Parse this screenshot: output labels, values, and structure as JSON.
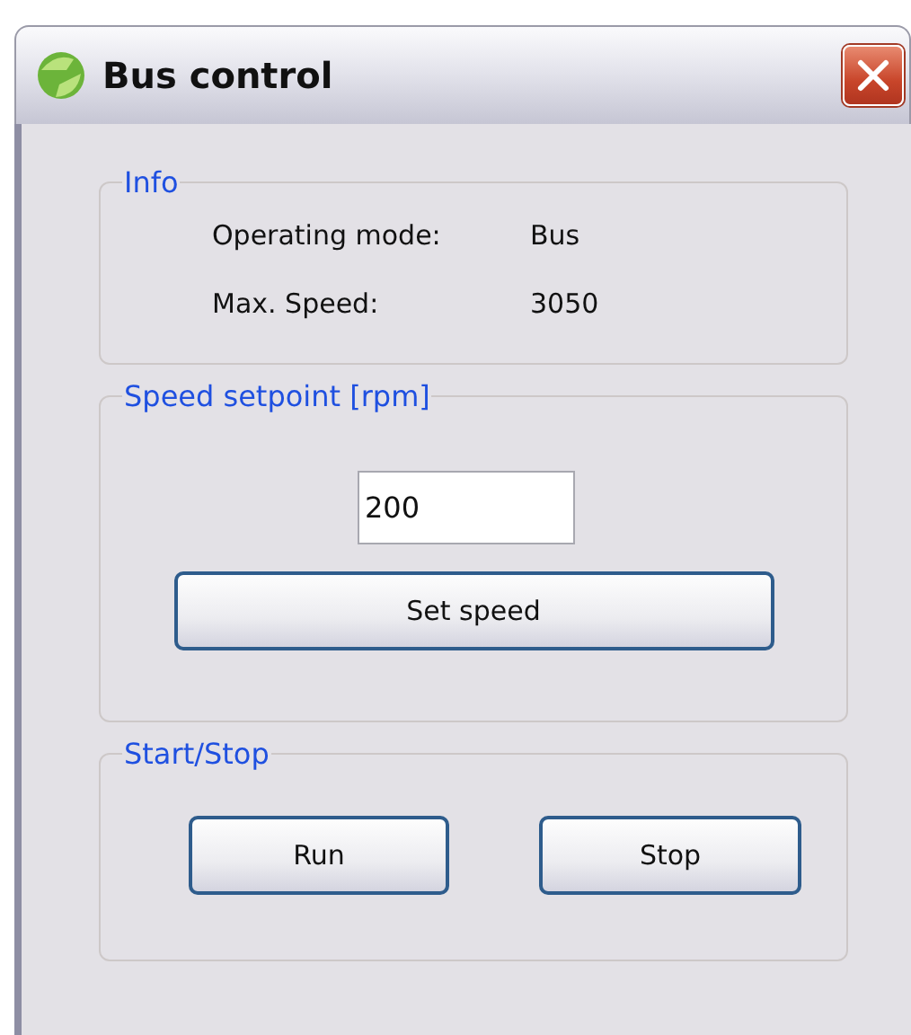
{
  "window": {
    "title": "Bus control"
  },
  "info": {
    "title": "Info",
    "rows": [
      {
        "label": "Operating mode:",
        "value": "Bus"
      },
      {
        "label": "Max. Speed:",
        "value": "3050"
      }
    ]
  },
  "speed_setpoint": {
    "title": "Speed setpoint [rpm]",
    "value": "200",
    "button": "Set speed"
  },
  "start_stop": {
    "title": "Start/Stop",
    "buttons": [
      "Run",
      "Stop"
    ]
  }
}
